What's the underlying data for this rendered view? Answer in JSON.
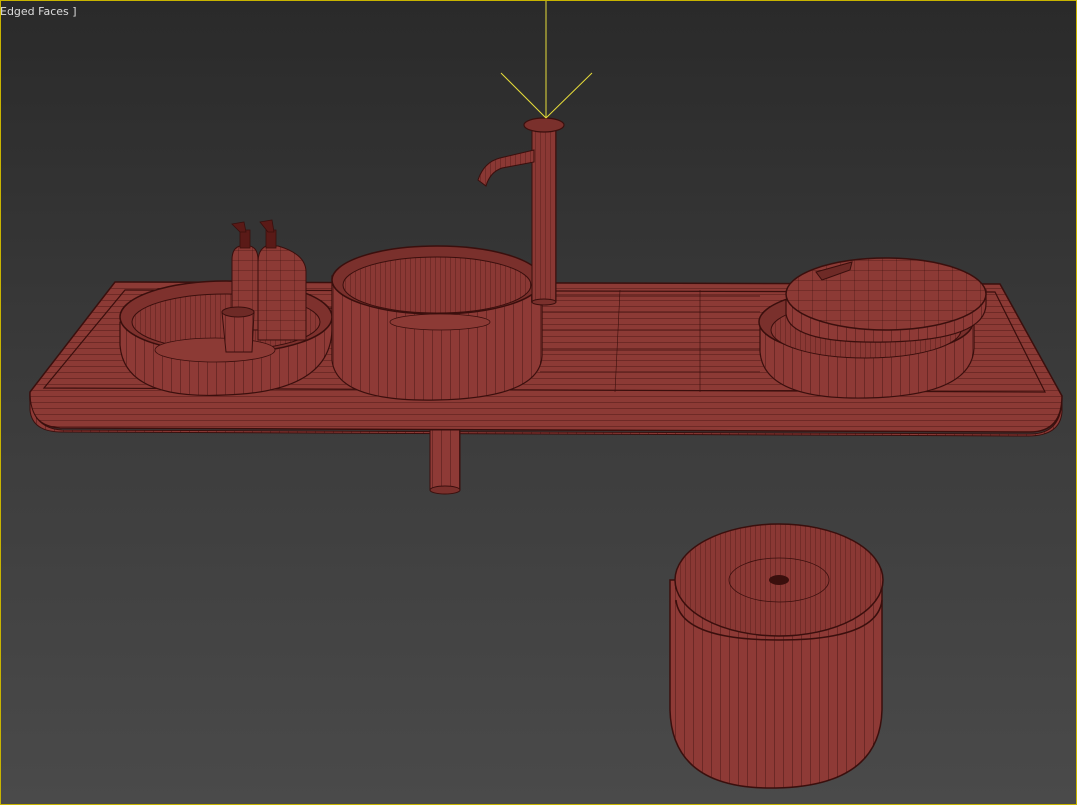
{
  "viewport": {
    "label": "Edged Faces ]",
    "border_color": "#c8b400",
    "background_top": "#2a2a2a",
    "background_bottom": "#4a4a4a"
  },
  "scene": {
    "object_color": "#8e3a36",
    "wire_color": "#3a0f0d",
    "gizmo_color": "#e6dc3a",
    "objects": [
      "countertop-tray",
      "left-bowl-basin",
      "soap-bottle-left",
      "soap-bottle-right",
      "small-cup",
      "center-sink-basin",
      "faucet",
      "drain-pipe",
      "right-bowl-basin",
      "right-bowl-lid",
      "floor-bin"
    ]
  }
}
